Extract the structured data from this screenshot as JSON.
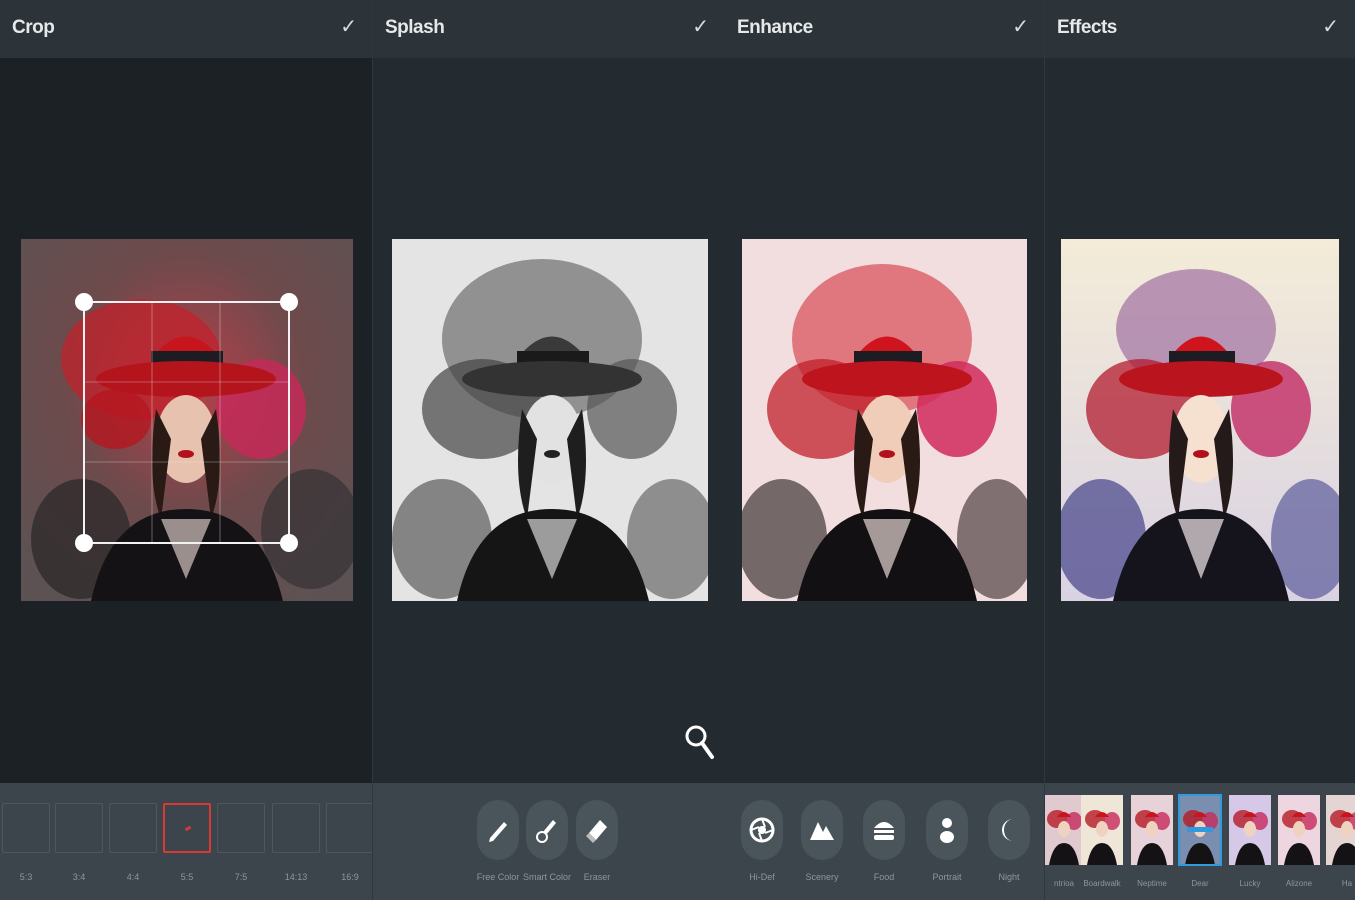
{
  "panels": {
    "crop": {
      "title": "Crop"
    },
    "splash": {
      "title": "Splash"
    },
    "enhance": {
      "title": "Enhance"
    },
    "effects": {
      "title": "Effects"
    }
  },
  "confirm_icon": "checkmark-icon",
  "crop_ratios": [
    "5:3",
    "3:4",
    "4:4",
    "5:5",
    "7:5",
    "14:13",
    "16:9"
  ],
  "crop_selected_index": 3,
  "splash_tools": [
    {
      "label": "Free Color",
      "icon": "pencil-icon"
    },
    {
      "label": "Smart Color",
      "icon": "brush-icon"
    },
    {
      "label": "Eraser",
      "icon": "eraser-icon"
    }
  ],
  "enhance_tools": [
    {
      "label": "Hi-Def",
      "icon": "aperture-icon"
    },
    {
      "label": "Scenery",
      "icon": "mountain-icon"
    },
    {
      "label": "Food",
      "icon": "burger-icon"
    },
    {
      "label": "Portrait",
      "icon": "person-icon"
    },
    {
      "label": "Night",
      "icon": "moon-icon"
    }
  ],
  "effects": [
    "ntrioa",
    "Boardwalk",
    "Neptime",
    "Dear",
    "Lucky",
    "Alizone",
    "Ha"
  ],
  "effects_selected_index": 3,
  "zoom_icon": "magnifier-icon",
  "colors": {
    "accent_red": "#d93a35",
    "accent_blue": "#2e9be0",
    "panel_bg": "#232b30",
    "toolbar_bg": "#3b454b"
  }
}
